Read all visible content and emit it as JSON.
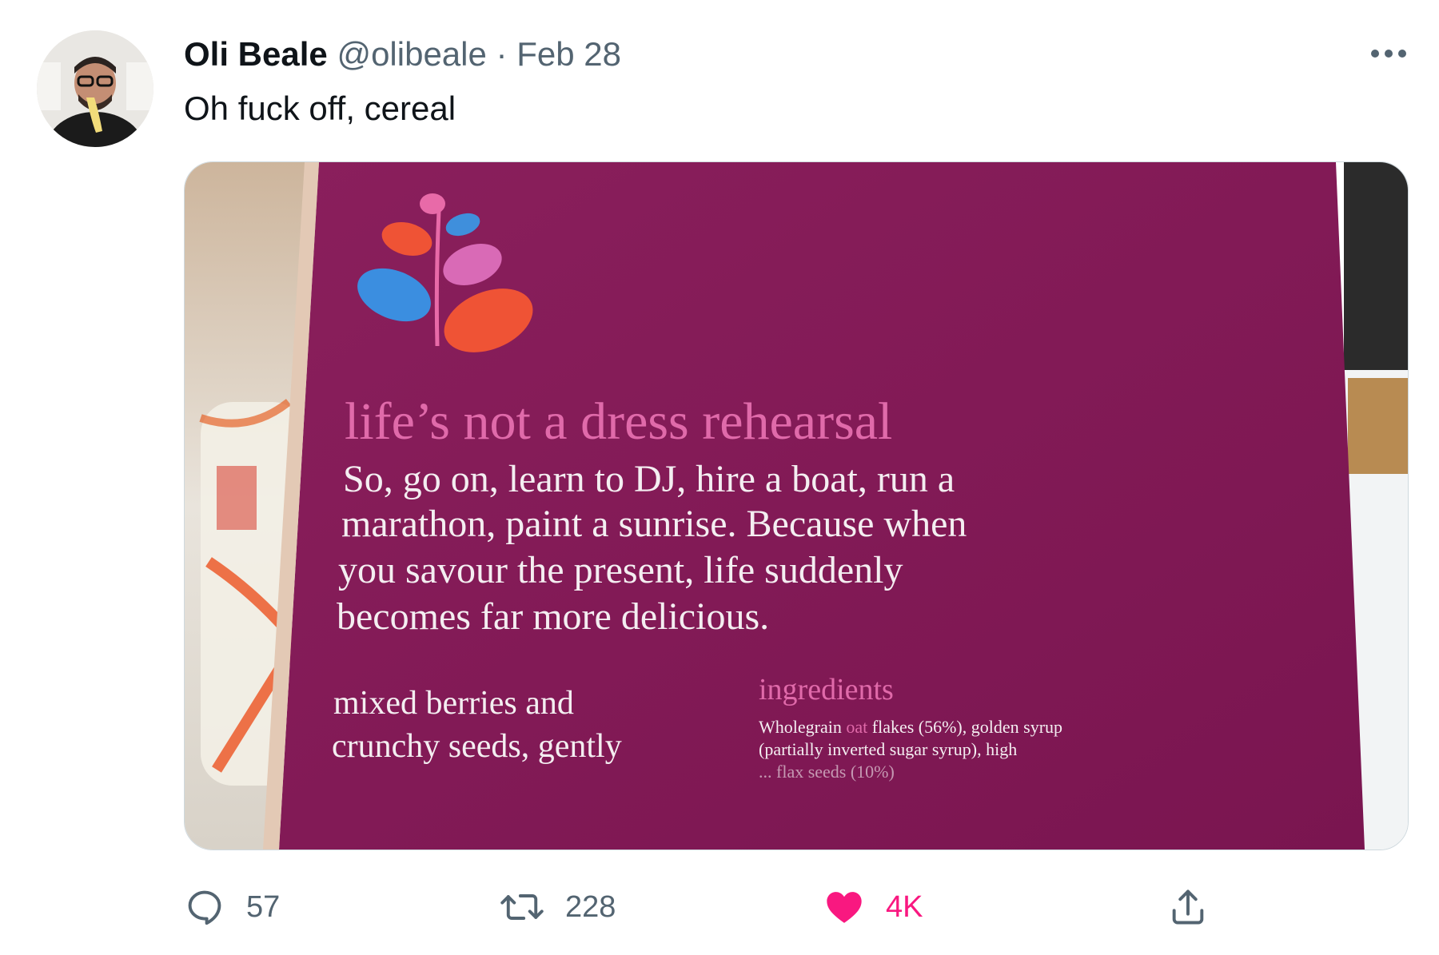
{
  "tweet": {
    "author_name": "Oli Beale",
    "author_handle": "@olibeale",
    "separator": "·",
    "date": "Feb 28",
    "text": "Oh fuck off, cereal",
    "media": {
      "headline": "life’s not a dress rehearsal",
      "body_lines": [
        "So, go on, learn to DJ, hire a boat, run a",
        "marathon, paint a sunrise. Because when",
        "you savour the present, life suddenly",
        "becomes far more delicious."
      ],
      "desc_lines": [
        "mixed berries and",
        "crunchy seeds, gently"
      ],
      "ingredients_heading": "ingredients",
      "ingredients_line1_a": "Wholegrain ",
      "ingredients_line1_b": "oat",
      "ingredients_line1_c": " flakes (56%), golden syrup",
      "ingredients_line2": "(partially inverted sugar syrup), high",
      "ingredients_line3": "... flax seeds (10%)"
    },
    "actions": {
      "reply_count": "57",
      "retweet_count": "228",
      "like_count": "4K"
    },
    "icons": {
      "more": "more-horizontal-icon",
      "reply": "reply-icon",
      "retweet": "retweet-icon",
      "like": "heart-icon",
      "share": "share-icon"
    },
    "colors": {
      "text_primary": "#0f1419",
      "text_secondary": "#536471",
      "like_active": "#f91880",
      "box_purple": "#8a1f5c",
      "headline_pink": "#e06aaa"
    }
  }
}
